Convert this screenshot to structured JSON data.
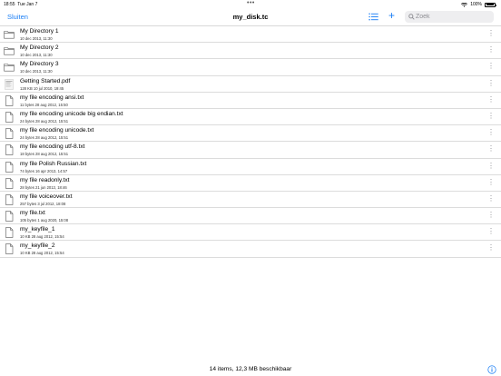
{
  "status": {
    "time": "18:55",
    "date": "Tue Jan 7",
    "battery": "100%"
  },
  "nav": {
    "close_label": "Sluiten",
    "title": "my_disk.tc",
    "search_placeholder": "Zoek"
  },
  "colors": {
    "accent": "#1a7ef5"
  },
  "items": [
    {
      "name": "My Directory 1",
      "meta": "10 dec 2013, 11:30",
      "kind": "folder"
    },
    {
      "name": "My Directory 2",
      "meta": "10 dec 2013, 11:30",
      "kind": "folder"
    },
    {
      "name": "My Directory 3",
      "meta": "10 dec 2013, 11:30",
      "kind": "folder"
    },
    {
      "name": "Getting Started.pdf",
      "meta": "128 KB  10 jul 2010, 19:45",
      "kind": "pdf"
    },
    {
      "name": "my file encoding ansi.txt",
      "meta": "11 bytes  28 aug 2012, 15:50",
      "kind": "file"
    },
    {
      "name": "my file encoding unicode big endian.txt",
      "meta": "24 bytes  28 aug 2012, 15:51",
      "kind": "file"
    },
    {
      "name": "my file encoding unicode.txt",
      "meta": "24 bytes  28 aug 2012, 15:51",
      "kind": "file"
    },
    {
      "name": "my file encoding utf-8.txt",
      "meta": "18 bytes  28 aug 2012, 15:51",
      "kind": "file"
    },
    {
      "name": "my file Polish Russian.txt",
      "meta": "74 bytes  16 apr 2013, 14:57",
      "kind": "file"
    },
    {
      "name": "my file readonly.txt",
      "meta": "28 bytes  21 jun 2013, 18:46",
      "kind": "file"
    },
    {
      "name": "my file voiceover.txt",
      "meta": "257 bytes  3 jul 2012, 18:08",
      "kind": "file"
    },
    {
      "name": "my file.txt",
      "meta": "105 bytes  1 aug 2020, 15:08",
      "kind": "file"
    },
    {
      "name": "my_keyfile_1",
      "meta": "10 KB  28 aug 2012, 15:54",
      "kind": "file"
    },
    {
      "name": "my_keyfile_2",
      "meta": "10 KB  28 aug 2012, 15:54",
      "kind": "file"
    }
  ],
  "footer": {
    "summary": "14 items, 12,3 MB beschikbaar"
  }
}
